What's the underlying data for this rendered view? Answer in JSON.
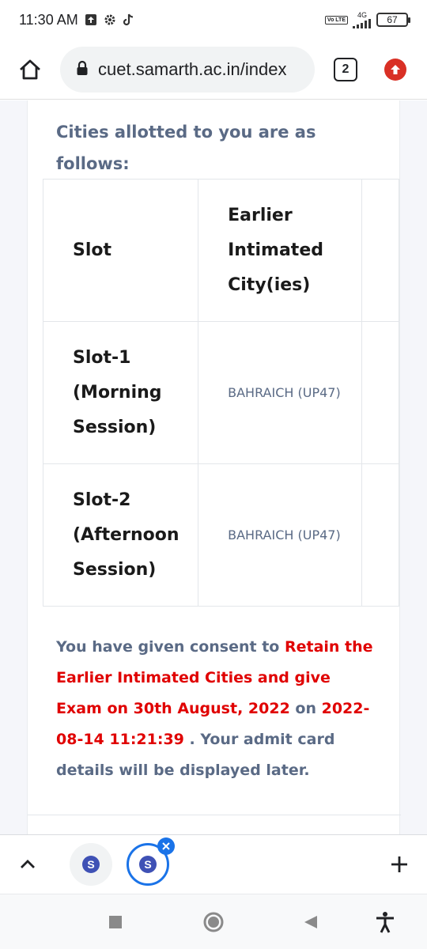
{
  "status_bar": {
    "time": "11:30 AM",
    "network": "4G",
    "volte": "Vo LTE",
    "battery": "67"
  },
  "browser": {
    "url": "cuet.samarth.ac.in/index",
    "tab_count": "2"
  },
  "page": {
    "intro": "Cities allotted to you are as follows:",
    "table": {
      "headers": [
        "Slot",
        "Earlier Intimated City(ies)"
      ],
      "rows": [
        {
          "slot": "Slot-1 (Morning Session)",
          "city": "BAHRAICH (UP47)"
        },
        {
          "slot": "Slot-2 (Afternoon Session)",
          "city": "BAHRAICH (UP47)"
        }
      ]
    },
    "consent": {
      "part1": "You have given consent to ",
      "highlight1": "Retain the Earlier Intimated Cities and give Exam on 30th August, 2022",
      "part2": " on ",
      "highlight2": "2022-08-14 11:21:39",
      "part3": " . Your admit card details will be displayed later."
    }
  },
  "tab_strip": {
    "tabs": [
      {
        "favicon": "S"
      },
      {
        "favicon": "S"
      }
    ]
  },
  "colors": {
    "highlight": "#e00000",
    "text_muted": "#5a6a85",
    "active_tab": "#1a73e8",
    "favicon": "#3f51b5"
  }
}
